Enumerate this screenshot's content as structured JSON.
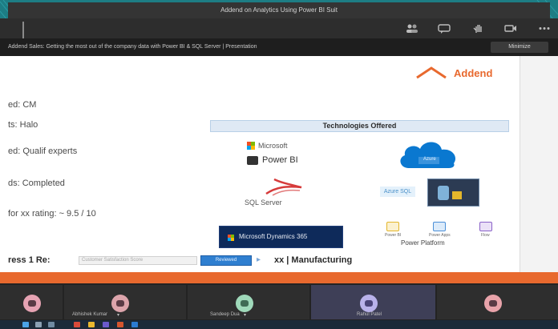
{
  "window": {
    "title": "Addend on Analytics Using Power BI Suit"
  },
  "toolbar": {
    "icons": [
      "participants-icon",
      "chat-icon",
      "raise-hand-icon",
      "video-icon",
      "more-icon"
    ]
  },
  "banner": {
    "text": "Addend Sales: Getting the most out of the company data with Power BI & SQL Server | Presentation",
    "button": "Minimize"
  },
  "slide": {
    "logo_text": "Addend",
    "left_items": [
      "ed: CM",
      "ts: Halo",
      "ed: Qualif experts",
      "ds: Completed",
      "for xx rating: ~ 9.5 / 10"
    ],
    "tech_header": "Technologies Offered",
    "microsoft": "Microsoft",
    "power_bi": "Power BI",
    "azure": "Azure",
    "sql_server": "SQL Server",
    "azure_sql": "Azure SQL",
    "dynamics": "Microsoft Dynamics 365",
    "power_platform": {
      "title": "Power Platform",
      "items": [
        "Power BI",
        "Power Apps",
        "Flow"
      ]
    },
    "bottom": {
      "prefix": "ress 1 Re:",
      "input_text": "Customer Satisfaction Score",
      "highlight": "Reviewed",
      "suffix": "xx | Manufacturing"
    }
  },
  "participants": [
    {
      "name": "",
      "avatar_color": "#e6a3b3"
    },
    {
      "name": "Abhishek Kumar",
      "avatar_color": "#dca4ab"
    },
    {
      "name": "Sandeep Dua",
      "avatar_color": "#9fd9ba"
    },
    {
      "name": "Rahul Patel",
      "avatar_color": "#b9b2ea"
    },
    {
      "name": "",
      "avatar_color": "#e8a3aa"
    }
  ],
  "colors": {
    "background": "#1d7d84",
    "accent": "#e8692e",
    "azure": "#0a78d0",
    "dynamics": "#0e2a5a",
    "active_tile": "#3e3f57"
  }
}
